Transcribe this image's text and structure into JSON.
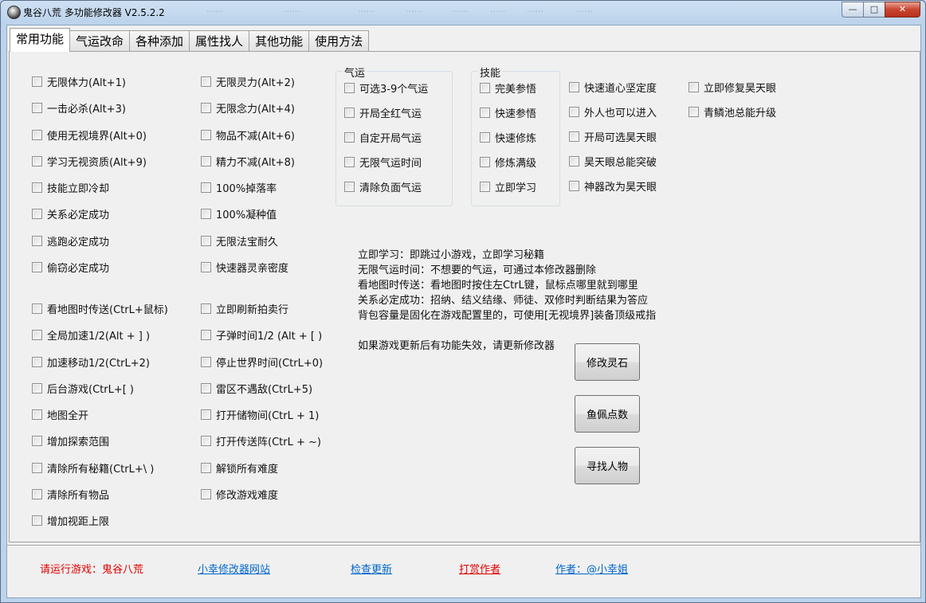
{
  "window": {
    "title": "鬼谷八荒 多功能修改器  V2.5.2.2",
    "ghost_titles": [
      "······",
      "······",
      "······",
      "······",
      "······",
      "······",
      "······"
    ],
    "ghost_caption": "······",
    "minimize_label": "—",
    "maximize_label": "□",
    "close_label": "✕"
  },
  "tabs": [
    "常用功能",
    "气运改命",
    "各种添加",
    "属性找人",
    "其他功能",
    "使用方法"
  ],
  "left_col1": [
    "无限体力(Alt+1)",
    "一击必杀(Alt+3)",
    "使用无视境界(Alt+0)",
    "学习无视资质(Alt+9)",
    "技能立即冷却",
    "关系必定成功",
    "逃跑必定成功",
    "偷窃必定成功",
    "看地图时传送(CtrL+鼠标)",
    "全局加速1/2(Alt + ] )",
    "加速移动1/2(CtrL+2)",
    "后台游戏(CtrL+[ )",
    "地图全开",
    "增加探索范围",
    "清除所有秘籍(CtrL+\\ )",
    "清除所有物品",
    "增加视距上限"
  ],
  "left_col2": [
    "无限灵力(Alt+2)",
    "无限念力(Alt+4)",
    "物品不减(Alt+6)",
    "精力不减(Alt+8)",
    "100%掉落率",
    "100%凝种值",
    "无限法宝耐久",
    "快速器灵亲密度",
    "立即刷新拍卖行",
    "子弹时间1/2 (Alt + [ )",
    "停止世界时间(CtrL+0)",
    "雷区不遇敌(CtrL+5)",
    "打开储物间(CtrL + 1)",
    "打开传送阵(CtrL + ~)",
    "解锁所有难度",
    "修改游戏难度"
  ],
  "qiyun": {
    "title": "气运",
    "items": [
      "可选3-9个气运",
      "开局全红气运",
      "自定开局气运",
      "无限气运时间",
      "清除负面气运"
    ]
  },
  "jineng": {
    "title": "技能",
    "items": [
      "完美参悟",
      "快速参悟",
      "快速修炼",
      "修炼满级",
      "立即学习"
    ]
  },
  "extra_col1": [
    "快速道心坚定度",
    "外人也可以进入",
    "开局可选昊天眼",
    "昊天眼总能突破",
    "神器改为昊天眼"
  ],
  "extra_col2": [
    "立即修复昊天眼",
    "青鳞池总能升级"
  ],
  "info": [
    "立即学习：即跳过小游戏，立即学习秘籍",
    "无限气运时间：不想要的气运，可通过本修改器删除",
    "看地图时传送：看地图时按住左CtrL键，鼠标点哪里就到哪里",
    "关系必定成功：招纳、结义结缘、师徒、双修时判断结果为答应",
    "背包容量是固化在游戏配置里的，可使用[无视境界]装备顶级戒指",
    "",
    "如果游戏更新后有功能失效，请更新修改器"
  ],
  "buttons": [
    "修改灵石",
    "鱼佩点数",
    "寻找人物"
  ],
  "footer": {
    "status": "请运行游戏：鬼谷八荒",
    "website": "小幸修改器网站",
    "check_update": "检查更新",
    "donate": "打赏作者",
    "author": "作者：@小幸姐"
  }
}
